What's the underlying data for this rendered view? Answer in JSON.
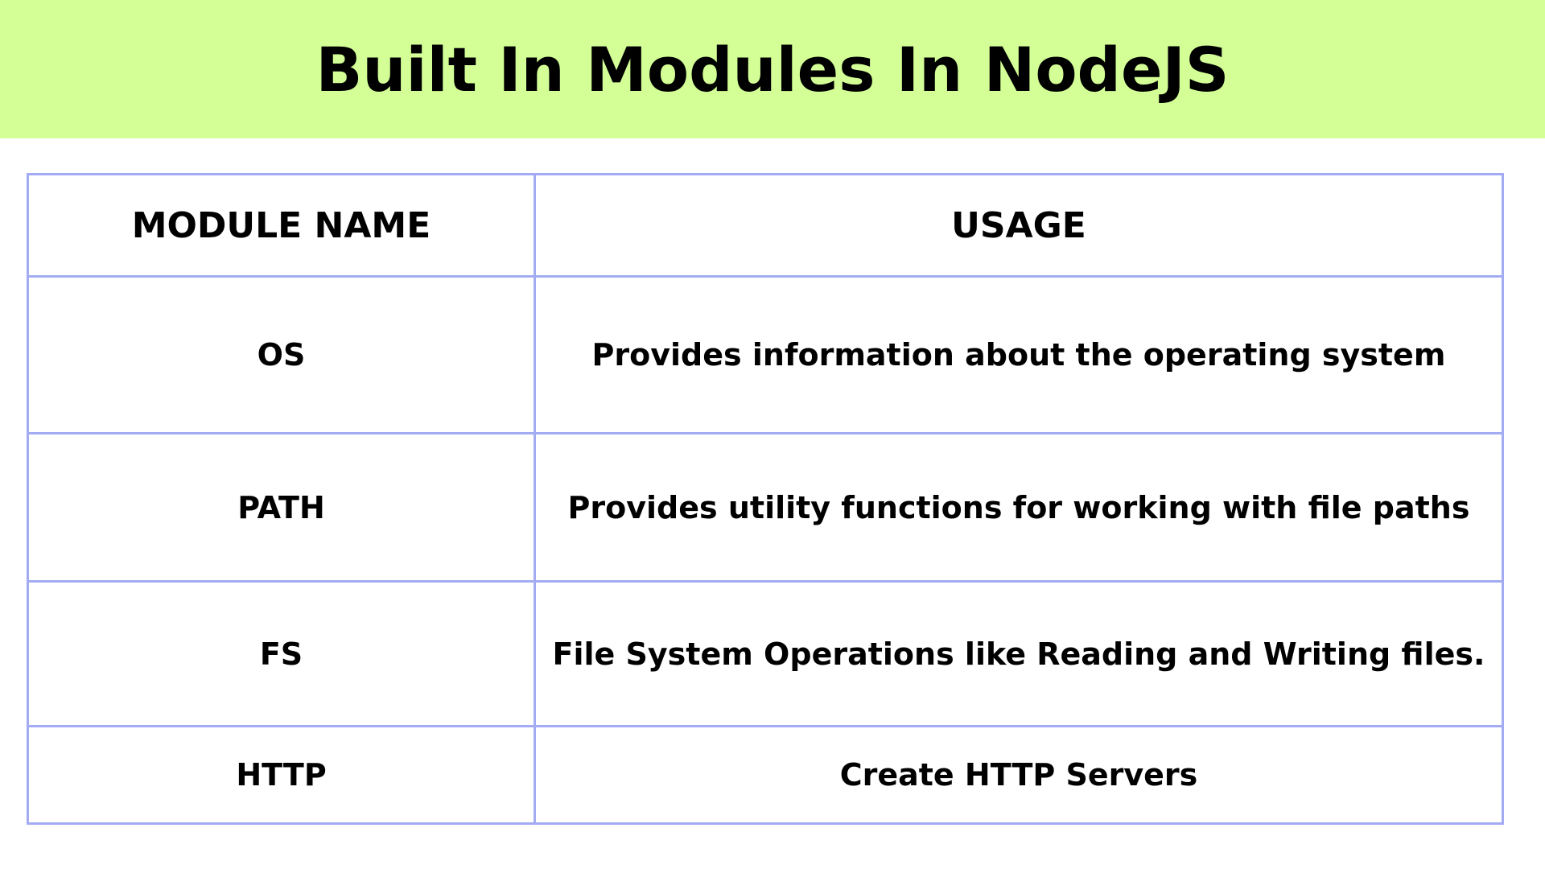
{
  "title": "Built In Modules In NodeJS",
  "colors": {
    "header_background": "#d4ff97",
    "table_border": "#a3acf3",
    "text": "#000000"
  },
  "table": {
    "headers": [
      "MODULE NAME",
      "USAGE"
    ],
    "rows": [
      {
        "module": "OS",
        "usage": "Provides information about the operating system"
      },
      {
        "module": "PATH",
        "usage": "Provides utility functions for working with file paths"
      },
      {
        "module": "FS",
        "usage": "File System Operations like Reading and Writing files."
      },
      {
        "module": "HTTP",
        "usage": "Create HTTP Servers"
      }
    ]
  }
}
